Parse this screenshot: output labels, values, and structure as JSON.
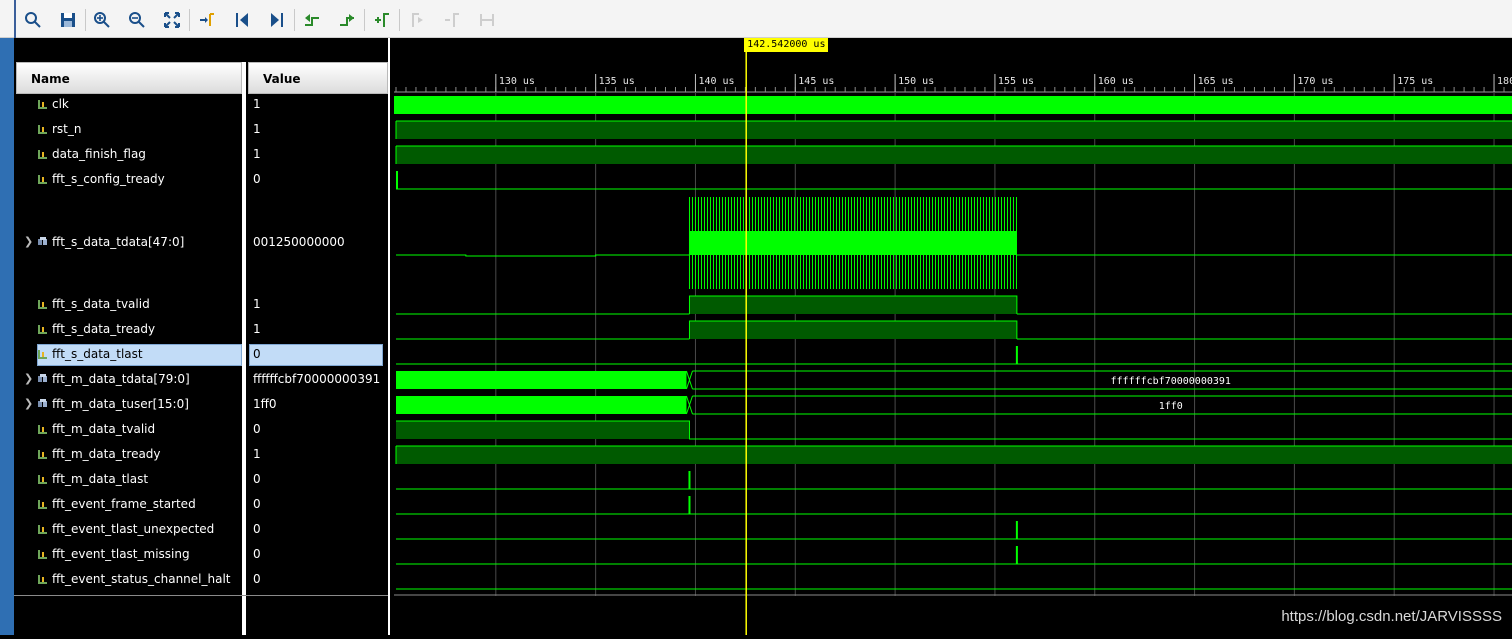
{
  "toolbar": {
    "buttons": [
      {
        "name": "zoom-search-icon"
      },
      {
        "name": "save-icon"
      },
      {
        "name": "zoom-in-icon"
      },
      {
        "name": "zoom-out-icon"
      },
      {
        "name": "zoom-fit-icon"
      },
      {
        "name": "go-to-cursor-icon"
      },
      {
        "name": "go-to-time-zero-icon"
      },
      {
        "name": "go-to-last-time-icon"
      },
      {
        "name": "previous-transition-icon"
      },
      {
        "name": "next-transition-icon"
      },
      {
        "name": "add-marker-icon"
      },
      {
        "name": "previous-marker-icon"
      },
      {
        "name": "next-marker-icon"
      },
      {
        "name": "swap-cursors-icon"
      }
    ]
  },
  "columns": {
    "name": "Name",
    "value": "Value"
  },
  "cursor": {
    "time_us": 142.542,
    "label": "142.542000 us",
    "color": "#ffff00"
  },
  "timeline": {
    "start_us": 124.9,
    "end_us": 180.9,
    "ticks": [
      "130 us",
      "135 us",
      "140 us",
      "145 us",
      "150 us",
      "155 us",
      "160 us",
      "165 us",
      "170 us",
      "175 us",
      "180 us"
    ],
    "tick_values": [
      130,
      135,
      140,
      145,
      150,
      155,
      160,
      165,
      170,
      175,
      180
    ]
  },
  "colors": {
    "wave": "#00ff00",
    "wave_dim": "#005a00",
    "grid": "#3a3a3a"
  },
  "signals": [
    {
      "name": "clk",
      "value": "1",
      "kind": "bit",
      "wave": "clock",
      "expandable": false
    },
    {
      "name": "rst_n",
      "value": "1",
      "kind": "bit",
      "wave": "high",
      "expandable": false
    },
    {
      "name": "data_finish_flag",
      "value": "1",
      "kind": "bit",
      "wave": "high",
      "expandable": false
    },
    {
      "name": "fft_s_config_tready",
      "value": "0",
      "kind": "bit",
      "wave": "pulse_start",
      "expandable": false
    },
    {
      "name": "fft_s_data_tdata[47:0]",
      "value": "001250000000",
      "kind": "bus",
      "wave": "analog_burst",
      "expandable": true
    },
    {
      "name": "fft_s_data_tvalid",
      "value": "1",
      "kind": "bit",
      "wave": "high_window",
      "expandable": false
    },
    {
      "name": "fft_s_data_tready",
      "value": "1",
      "kind": "bit",
      "wave": "high_window",
      "expandable": false
    },
    {
      "name": "fft_s_data_tlast",
      "value": "0",
      "kind": "bit",
      "wave": "pulse_end",
      "expandable": false,
      "selected": true
    },
    {
      "name": "fft_m_data_tdata[79:0]",
      "value": "ffffffcbf70000000391",
      "kind": "bus",
      "wave": "bus_value",
      "bus_text": "ffffffcbf70000000391",
      "expandable": true
    },
    {
      "name": "fft_m_data_tuser[15:0]",
      "value": "1ff0",
      "kind": "bus",
      "wave": "bus_value",
      "bus_text": "1ff0",
      "expandable": true
    },
    {
      "name": "fft_m_data_tvalid",
      "value": "0",
      "kind": "bit",
      "wave": "high_until",
      "expandable": false
    },
    {
      "name": "fft_m_data_tready",
      "value": "1",
      "kind": "bit",
      "wave": "high",
      "expandable": false
    },
    {
      "name": "fft_m_data_tlast",
      "value": "0",
      "kind": "bit",
      "wave": "pulse_mid",
      "expandable": false
    },
    {
      "name": "fft_event_frame_started",
      "value": "0",
      "kind": "bit",
      "wave": "pulse_mid",
      "expandable": false
    },
    {
      "name": "fft_event_tlast_unexpected",
      "value": "0",
      "kind": "bit",
      "wave": "pulse_end",
      "expandable": false
    },
    {
      "name": "fft_event_tlast_missing",
      "value": "0",
      "kind": "bit",
      "wave": "pulse_end",
      "expandable": false
    },
    {
      "name": "fft_event_status_channel_halt",
      "value": "0",
      "kind": "bit",
      "wave": "low",
      "expandable": false
    }
  ],
  "events_us": {
    "burst_start": 139.7,
    "burst_end": 156.1,
    "config_pulse": 124.95
  },
  "watermark": "https://blog.csdn.net/JARVISSSS"
}
